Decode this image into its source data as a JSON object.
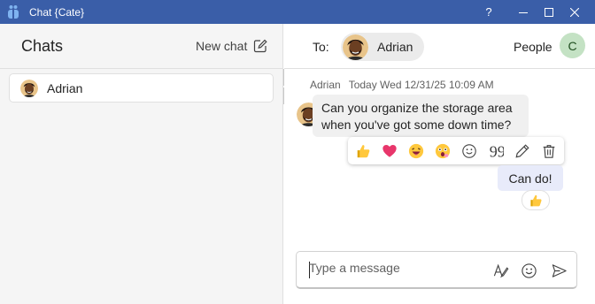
{
  "window": {
    "title": "Chat {Cate}",
    "help_label": "?"
  },
  "sidebar": {
    "title": "Chats",
    "new_chat_label": "New chat",
    "chats": [
      {
        "name": "Adrian"
      }
    ]
  },
  "conversation": {
    "to_label": "To:",
    "recipient": "Adrian",
    "people_label": "People",
    "user_initial": "C",
    "messages": [
      {
        "sender": "Adrian",
        "timestamp": "Today Wed 12/31/25 10:09 AM",
        "text_line1": "Can you organize the storage area",
        "text_line2": "when you've got some down time?"
      }
    ],
    "my_message": {
      "text": "Can do!",
      "reaction": "thumbs-up"
    },
    "reactions": [
      "thumbs-up",
      "heart",
      "laughing",
      "surprised",
      "emoji",
      "quote",
      "edit",
      "delete"
    ]
  },
  "composer": {
    "placeholder": "Type a message"
  },
  "colors": {
    "titlebar": "#3a5ea8",
    "my_bubble": "#e8ebfa",
    "other_bubble": "#f0f0f0",
    "user_avatar": "#c4e2c4"
  }
}
